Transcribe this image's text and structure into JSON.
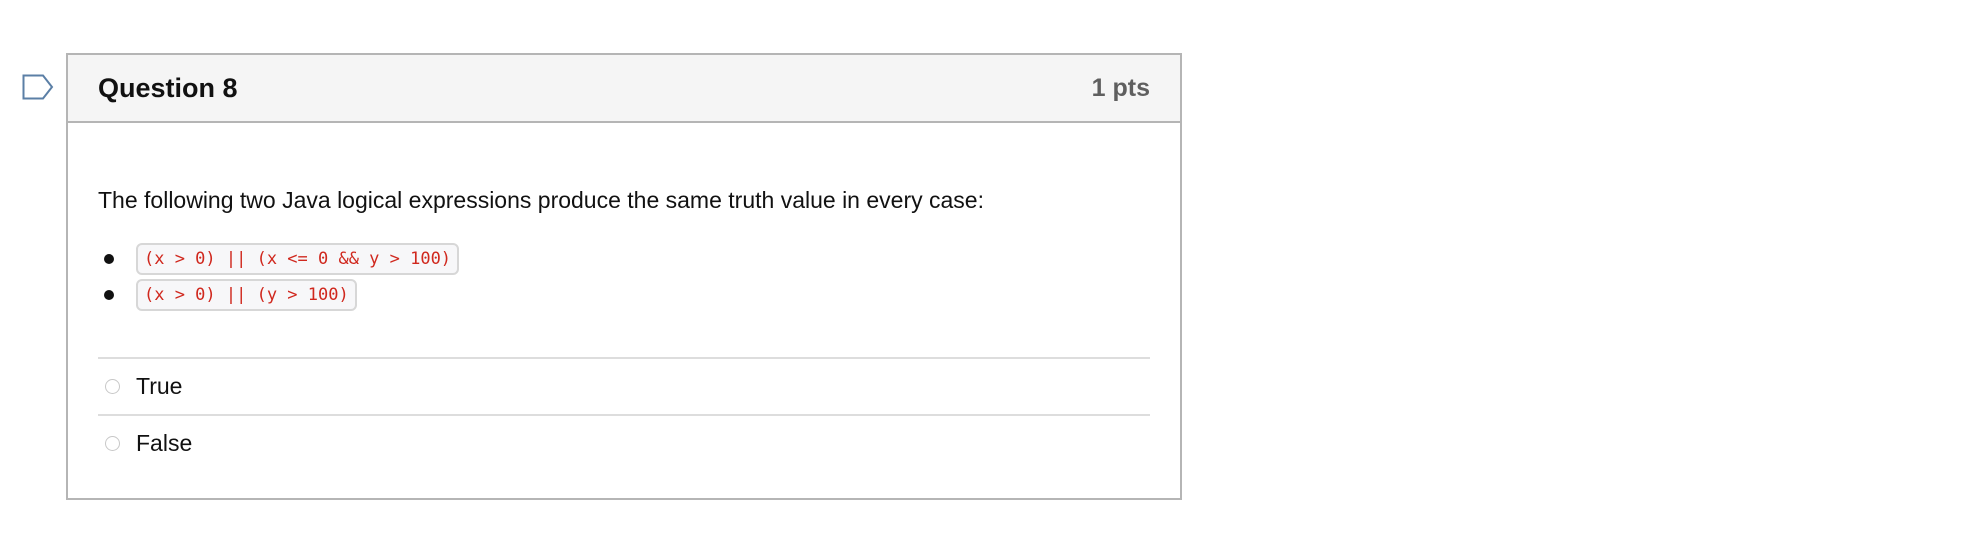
{
  "question": {
    "title": "Question 8",
    "points": "1 pts",
    "text": "The following two Java logical expressions produce the same truth value in every case:",
    "expressions": [
      "(x > 0) || (x <= 0 && y > 100)",
      "(x > 0) || (y > 100)"
    ],
    "answers": [
      {
        "label": "True",
        "selected": false
      },
      {
        "label": "False",
        "selected": false
      }
    ]
  },
  "icons": {
    "flag": "bookmark-flag-icon",
    "radio": "radio-unselected-icon"
  },
  "colors": {
    "flag_outline": "#5b7fa6",
    "code_text": "#d0281e",
    "header_background": "#f5f5f5",
    "points_text": "#5f5f5f"
  }
}
